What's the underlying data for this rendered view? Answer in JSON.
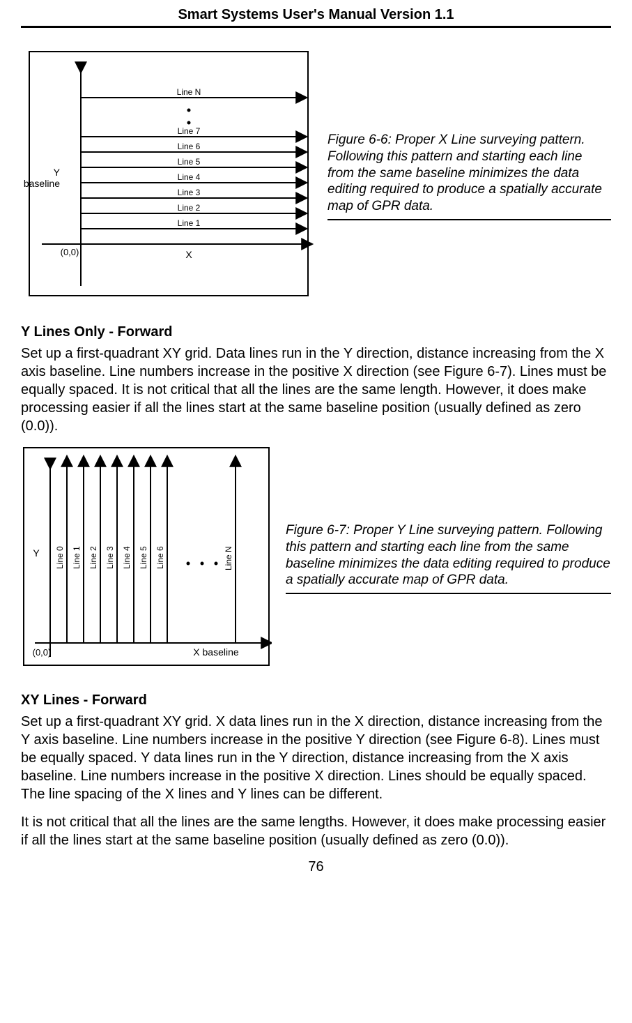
{
  "header": {
    "title": "Smart Systems User's Manual Version 1.1"
  },
  "footer": {
    "page_number": "76"
  },
  "figure1": {
    "caption": "Figure 6-6: Proper X Line surveying pattern. Following this pattern and starting each line from the same baseline minimizes the data editing required to produce a spatially accurate map of GPR data.",
    "y_axis_label1": "Y",
    "y_axis_label2": "baseline",
    "x_axis_label": "X",
    "origin_label": "(0,0)",
    "lines": [
      "Line 1",
      "Line 2",
      "Line 3",
      "Line 4",
      "Line 5",
      "Line 6",
      "Line 7",
      "Line N"
    ]
  },
  "section1": {
    "heading": "Y Lines Only - Forward",
    "body": "Set up a first-quadrant XY grid.  Data lines run in the Y direction, distance increasing from the X axis baseline.  Line numbers increase in the positive X direction (see Figure 6-7).  Lines must be equally spaced.  It is not critical that all the lines are the same length.  However, it does make processing easier if all the lines start at the same baseline position (usually defined as zero (0.0))."
  },
  "figure2": {
    "caption": "Figure 6-7: Proper Y Line surveying pattern. Following this pattern and starting each line from the same baseline minimizes the data editing required to produce a spatially accurate map of GPR data.",
    "y_axis_label": "Y",
    "x_axis_label": "X  baseline",
    "origin_label": "(0,0)",
    "lines": [
      "Line 0",
      "Line 1",
      "Line 2",
      "Line 3",
      "Line 4",
      "Line 5",
      "Line 6",
      "Line N"
    ]
  },
  "section2": {
    "heading": "XY Lines - Forward",
    "body1": "Set up a first-quadrant XY grid. X data lines run in the X direction, distance increasing from the Y axis baseline.  Line numbers increase in the positive Y direction (see Figure 6-8). Lines must be equally spaced. Y data lines run in the Y direction, distance increasing from the X axis baseline.  Line numbers increase in the positive X direction.  Lines should be equally spaced.  The line spacing of the X lines and Y lines can be different.",
    "body2": "It is not critical that all the lines are the same lengths.  However, it does make processing easier if all the lines start at the same baseline position (usually defined as zero (0.0))."
  }
}
